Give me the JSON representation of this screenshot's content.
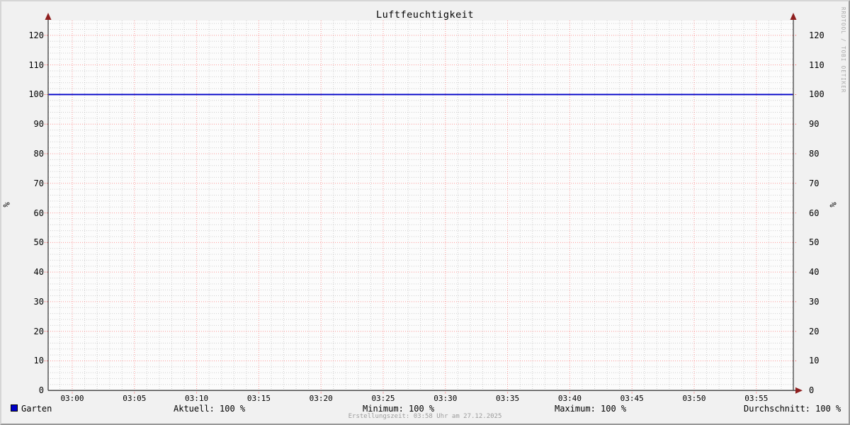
{
  "title": "Luftfeuchtigkeit",
  "watermark": "RRDTOOL / TOBI OETIKER",
  "footer": {
    "text": "Erstellungszeit: 03:58 Uhr am 27.12.2025"
  },
  "y_axis": {
    "unit_left": "%",
    "unit_right": "%",
    "tick_labels": [
      "0",
      "10",
      "20",
      "30",
      "40",
      "50",
      "60",
      "70",
      "80",
      "90",
      "100",
      "110",
      "120"
    ],
    "tick_values": [
      0,
      10,
      20,
      30,
      40,
      50,
      60,
      70,
      80,
      90,
      100,
      110,
      120
    ]
  },
  "x_axis": {
    "tick_labels": [
      "03:00",
      "03:05",
      "03:10",
      "03:15",
      "03:20",
      "03:25",
      "03:30",
      "03:35",
      "03:40",
      "03:45",
      "03:50",
      "03:55"
    ]
  },
  "legend": {
    "series": {
      "label": "Garten",
      "color": "#0000c8"
    },
    "stats": [
      {
        "label": "Aktuell",
        "value": "100 %",
        "text": "Aktuell: 100 %"
      },
      {
        "label": "Minimum",
        "value": "100 %",
        "text": "Minimum: 100 %"
      },
      {
        "label": "Maximum",
        "value": "100 %",
        "text": "Maximum: 100 %"
      },
      {
        "label": "Durchschnitt",
        "value": "100 %",
        "text": "Durchschnitt: 100 %"
      }
    ]
  },
  "colors": {
    "background": "#f1f1f1",
    "canvas": "#fcfcfc",
    "series": "#0000c8",
    "grid_major": "#ff0000",
    "grid_minor": "#999999",
    "axis": "#4d4d4d",
    "arrow": "#8f1f1f",
    "text": "#000000",
    "muted_text": "#9c9c9c"
  },
  "chart_data": {
    "type": "line",
    "title": "Luftfeuchtigkeit",
    "xlabel": "",
    "ylabel": "%",
    "ylim": [
      0,
      125
    ],
    "y_tick_step": 10,
    "grid": "on",
    "legend_position": "bottom",
    "x": [
      "03:00",
      "03:05",
      "03:10",
      "03:15",
      "03:20",
      "03:25",
      "03:30",
      "03:35",
      "03:40",
      "03:45",
      "03:50",
      "03:55"
    ],
    "series": [
      {
        "name": "Garten",
        "color": "#0000c8",
        "values": [
          100,
          100,
          100,
          100,
          100,
          100,
          100,
          100,
          100,
          100,
          100,
          100
        ]
      }
    ],
    "stats": {
      "aktuell": 100,
      "minimum": 100,
      "maximum": 100,
      "durchschnitt": 100,
      "unit": "%"
    }
  }
}
